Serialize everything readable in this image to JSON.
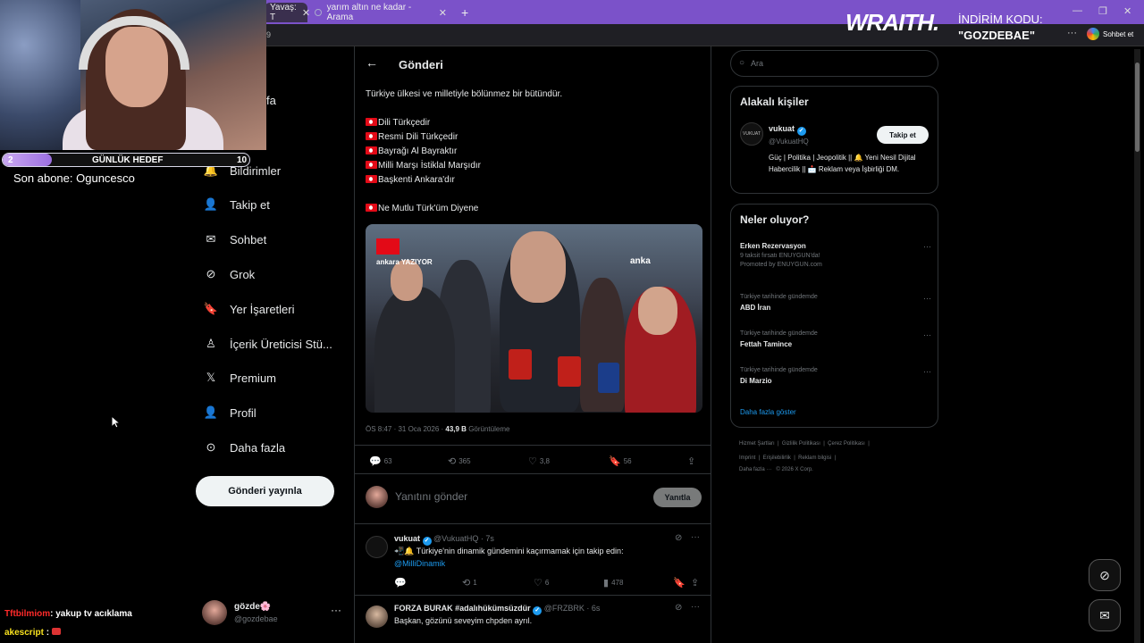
{
  "browser": {
    "tabs": [
      {
        "label": "Yavaş: T",
        "active": true
      },
      {
        "label": "yarım altın ne kadar - Arama",
        "active": false
      }
    ],
    "new_tab_symbol": "+",
    "address_fragment": "9"
  },
  "stream": {
    "goal": {
      "current": "2",
      "label": "GÜNLÜK HEDEF",
      "target": "10",
      "progress": 0.2
    },
    "last_sub": "Son abone: Oguncesco",
    "chat": [
      {
        "user": "Tftbilmiom",
        "text": ": yakup tv acıklama"
      },
      {
        "user": "akescript",
        "text": ":"
      }
    ],
    "sponsor": {
      "brand": "WRAITH.",
      "promo_line1": "İNDİRİM KODU:",
      "promo_line2": "\"GOZDEBAE\""
    }
  },
  "sidebar": {
    "partial_label": "fa",
    "items": [
      {
        "label": "Bildirimler",
        "icon": "bell-icon"
      },
      {
        "label": "Takip et",
        "icon": "person-add-icon"
      },
      {
        "label": "Sohbet",
        "icon": "mail-icon"
      },
      {
        "label": "Grok",
        "icon": "grok-icon"
      },
      {
        "label": "Yer İşaretleri",
        "icon": "bookmark-icon"
      },
      {
        "label": "İçerik Üreticisi Stü...",
        "icon": "creator-icon"
      },
      {
        "label": "Premium",
        "icon": "x-logo-icon"
      },
      {
        "label": "Profil",
        "icon": "person-icon"
      },
      {
        "label": "Daha fazla",
        "icon": "more-circle-icon"
      }
    ],
    "post_button": "Gönderi yayınla",
    "account": {
      "name": "gözde🌸",
      "handle": "@gozdebae",
      "more": "···"
    }
  },
  "main": {
    "title": "Gönderi",
    "post_lines": [
      {
        "text": "Türkiye ülkesi ve milletiyle bölünmez bir bütündür.",
        "flag": false
      },
      {
        "text": "Dili Türkçedir",
        "flag": true
      },
      {
        "text": "Resmi Dili Türkçedir",
        "flag": true
      },
      {
        "text": "Bayrağı Al Bayraktır",
        "flag": true
      },
      {
        "text": "Milli Marşı İstiklal Marşıdır",
        "flag": true
      },
      {
        "text": "Başkenti Ankara'dır",
        "flag": true
      },
      {
        "text": "Ne Mutlu Türk'üm Diyene",
        "flag": true
      }
    ],
    "image_tags": {
      "left": "ankara YAZIYOR",
      "right": "anka"
    },
    "meta": {
      "time": "ÖS 8:47 · 31 Oca 2026 · ",
      "views": "43,9 B",
      "views_label": " Görüntüleme"
    },
    "actions": {
      "replies": "63",
      "reposts": "365",
      "likes": "3,8",
      "bookmarks": "56"
    },
    "reply_placeholder": "Yanıtını gönder",
    "reply_button": "Yanıtla",
    "replies": [
      {
        "name": "vukuat",
        "handle": "@VukuatHQ · 7s",
        "text": "📲🔔 Türkiye'nin dinamik gündemini kaçırmamak için takip edin:",
        "link": "@MilliDinamik",
        "stats": {
          "replies": "",
          "reposts": "1",
          "likes": "6",
          "views": "478"
        }
      },
      {
        "name": "FORZA BURAK #adalıhükümsüzdür",
        "handle": "@FRZBRK · 6s",
        "text": "Başkan, gözünü seveyim chpden ayrıl."
      }
    ]
  },
  "right": {
    "search_placeholder": "Ara",
    "relevant_title": "Alakalı kişiler",
    "relevant": {
      "name": "vukuat",
      "handle": "@VukuatHQ",
      "avatar_text": "VUKUAT",
      "bio": "Güç | Politika | Jeopolitik || 🔔 Yeni Nesil Dijital Habercilik || 📩 Reklam veya İşbirliği DM.",
      "follow": "Takip et"
    },
    "trends_title": "Neler oluyor?",
    "trends": [
      {
        "name": "Erken Rezervasyon",
        "sub": "9 taksit fırsatı ENUYGUN'da!",
        "promoted": "Promoted by ENUYGUN.com"
      },
      {
        "context": "Türkiye tarihinde gündemde",
        "name": "ABD İran"
      },
      {
        "context": "Türkiye tarihinde gündemde",
        "name": "Fettah Tamince"
      },
      {
        "context": "Türkiye tarihinde gündemde",
        "name": "Di Marzio"
      }
    ],
    "show_more": "Daha fazla göster",
    "footer": [
      [
        "Hizmet Şartları",
        "Gizlilik Politikası",
        "Çerez Politikası"
      ],
      [
        "Imprint",
        "Erişilebilirlik",
        "Reklam bilgisi"
      ],
      [
        "Daha fazla ···",
        "© 2026 X Corp."
      ]
    ],
    "chat_label": "Sohbet et"
  },
  "colors": {
    "accent": "#1d9bf0",
    "tabbar": "#7b52c9",
    "background": "#000000"
  }
}
